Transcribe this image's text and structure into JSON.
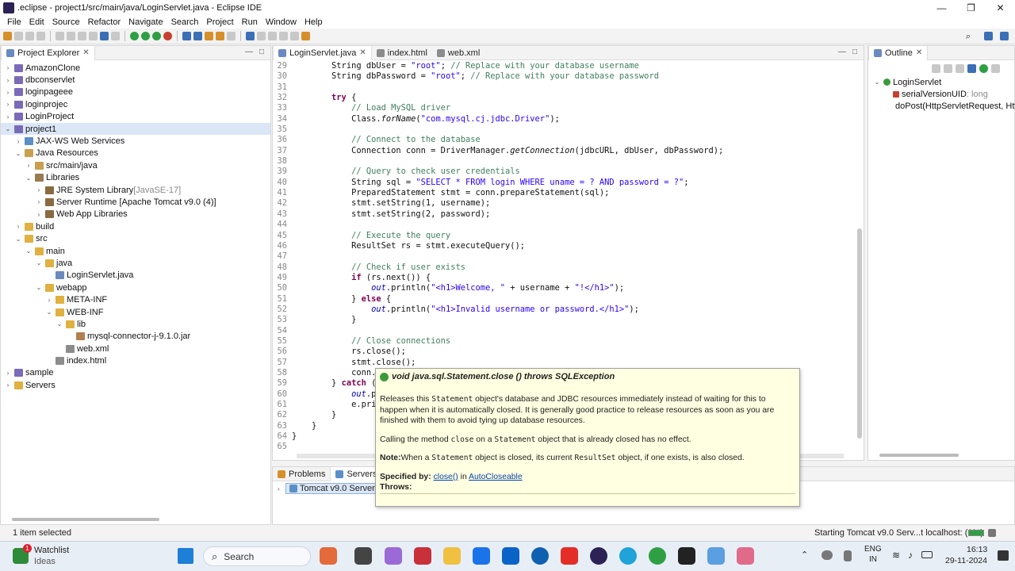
{
  "window": {
    "title": ".eclipse - project1/src/main/java/LoginServlet.java - Eclipse IDE",
    "controls": [
      "—",
      "❐",
      "✕"
    ]
  },
  "menu": [
    "File",
    "Edit",
    "Source",
    "Refactor",
    "Navigate",
    "Search",
    "Project",
    "Run",
    "Window",
    "Help"
  ],
  "explorer": {
    "title": "Project Explorer",
    "rows": [
      {
        "label": "AmazonClone",
        "deco": "",
        "indent": 0,
        "arrow": "›",
        "icon": "project-icon",
        "color": "#7a6bb8"
      },
      {
        "label": "dbconservlet",
        "deco": "",
        "indent": 0,
        "arrow": "›",
        "icon": "project-icon",
        "color": "#7a6bb8"
      },
      {
        "label": "loginpageee",
        "deco": "",
        "indent": 0,
        "arrow": "›",
        "icon": "project-icon",
        "color": "#7a6bb8"
      },
      {
        "label": "loginprojec",
        "deco": "",
        "indent": 0,
        "arrow": "›",
        "icon": "project-icon",
        "color": "#7a6bb8"
      },
      {
        "label": "LoginProject",
        "deco": "",
        "indent": 0,
        "arrow": "›",
        "icon": "project-icon",
        "color": "#7a6bb8"
      },
      {
        "label": "project1",
        "deco": "",
        "indent": 0,
        "arrow": "⌄",
        "icon": "project-icon",
        "color": "#7a6bb8",
        "selected": true
      },
      {
        "label": "JAX-WS Web Services",
        "deco": "",
        "indent": 1,
        "arrow": "›",
        "icon": "webservice-icon",
        "color": "#5a8fc8"
      },
      {
        "label": "Java Resources",
        "deco": "",
        "indent": 1,
        "arrow": "⌄",
        "icon": "java-resources-icon",
        "color": "#c8a050"
      },
      {
        "label": "src/main/java",
        "deco": "",
        "indent": 2,
        "arrow": "›",
        "icon": "source-folder-icon",
        "color": "#c8a050"
      },
      {
        "label": "Libraries",
        "deco": "",
        "indent": 2,
        "arrow": "⌄",
        "icon": "libraries-icon",
        "color": "#9a7a50"
      },
      {
        "label": "JRE System Library ",
        "deco": "[JavaSE-17]",
        "indent": 3,
        "arrow": "›",
        "icon": "library-icon",
        "color": "#8a6a40"
      },
      {
        "label": "Server Runtime [Apache Tomcat v9.0 (4)]",
        "deco": "",
        "indent": 3,
        "arrow": "›",
        "icon": "library-icon",
        "color": "#8a6a40"
      },
      {
        "label": "Web App Libraries",
        "deco": "",
        "indent": 3,
        "arrow": "›",
        "icon": "library-icon",
        "color": "#8a6a40"
      },
      {
        "label": "build",
        "deco": "",
        "indent": 1,
        "arrow": "›",
        "icon": "folder-icon",
        "color": "#e0b040"
      },
      {
        "label": "src",
        "deco": "",
        "indent": 1,
        "arrow": "⌄",
        "icon": "folder-icon",
        "color": "#e0b040"
      },
      {
        "label": "main",
        "deco": "",
        "indent": 2,
        "arrow": "⌄",
        "icon": "folder-icon",
        "color": "#e0b040"
      },
      {
        "label": "java",
        "deco": "",
        "indent": 3,
        "arrow": "⌄",
        "icon": "folder-icon",
        "color": "#e0b040"
      },
      {
        "label": "LoginServlet.java",
        "deco": "",
        "indent": 4,
        "arrow": "",
        "icon": "java-file-icon",
        "color": "#6a8ac0"
      },
      {
        "label": "webapp",
        "deco": "",
        "indent": 3,
        "arrow": "⌄",
        "icon": "folder-icon",
        "color": "#e0b040"
      },
      {
        "label": "META-INF",
        "deco": "",
        "indent": 4,
        "arrow": "›",
        "icon": "folder-icon",
        "color": "#e0b040"
      },
      {
        "label": "WEB-INF",
        "deco": "",
        "indent": 4,
        "arrow": "⌄",
        "icon": "folder-icon",
        "color": "#e0b040"
      },
      {
        "label": "lib",
        "deco": "",
        "indent": 5,
        "arrow": "⌄",
        "icon": "folder-icon",
        "color": "#e0b040"
      },
      {
        "label": "mysql-connector-j-9.1.0.jar",
        "deco": "",
        "indent": 6,
        "arrow": "",
        "icon": "jar-icon",
        "color": "#b08050"
      },
      {
        "label": "web.xml",
        "deco": "",
        "indent": 5,
        "arrow": "",
        "icon": "xml-file-icon",
        "color": "#8c8c8c"
      },
      {
        "label": "index.html",
        "deco": "",
        "indent": 4,
        "arrow": "",
        "icon": "html-file-icon",
        "color": "#8c8c8c"
      },
      {
        "label": "sample",
        "deco": "",
        "indent": 0,
        "arrow": "›",
        "icon": "project-icon",
        "color": "#7a6bb8"
      },
      {
        "label": "Servers",
        "deco": "",
        "indent": 0,
        "arrow": "›",
        "icon": "folder-icon",
        "color": "#e0b040"
      }
    ]
  },
  "editor": {
    "tabs": [
      {
        "label": "LoginServlet.java",
        "active": true,
        "close": "✕"
      },
      {
        "label": "index.html",
        "active": false,
        "close": ""
      },
      {
        "label": "web.xml",
        "active": false,
        "close": ""
      }
    ],
    "lines": [
      {
        "n": "29",
        "t": "        String dbUser = \"root\"; // Replace with your database username"
      },
      {
        "n": "30",
        "t": "        String dbPassword = \"root\"; // Replace with your database password"
      },
      {
        "n": "31",
        "t": ""
      },
      {
        "n": "32",
        "t": "        try {"
      },
      {
        "n": "33",
        "t": "            // Load MySQL driver"
      },
      {
        "n": "34",
        "t": "            Class.forName(\"com.mysql.cj.jdbc.Driver\");"
      },
      {
        "n": "35",
        "t": ""
      },
      {
        "n": "36",
        "t": "            // Connect to the database"
      },
      {
        "n": "37",
        "t": "            Connection conn = DriverManager.getConnection(jdbcURL, dbUser, dbPassword);"
      },
      {
        "n": "38",
        "t": ""
      },
      {
        "n": "39",
        "t": "            // Query to check user credentials"
      },
      {
        "n": "40",
        "t": "            String sql = \"SELECT * FROM login WHERE uname = ? AND password = ?\";"
      },
      {
        "n": "41",
        "t": "            PreparedStatement stmt = conn.prepareStatement(sql);"
      },
      {
        "n": "42",
        "t": "            stmt.setString(1, username);"
      },
      {
        "n": "43",
        "t": "            stmt.setString(2, password);"
      },
      {
        "n": "44",
        "t": ""
      },
      {
        "n": "45",
        "t": "            // Execute the query"
      },
      {
        "n": "46",
        "t": "            ResultSet rs = stmt.executeQuery();"
      },
      {
        "n": "47",
        "t": ""
      },
      {
        "n": "48",
        "t": "            // Check if user exists"
      },
      {
        "n": "49",
        "t": "            if (rs.next()) {"
      },
      {
        "n": "50",
        "t": "                out.println(\"<h1>Welcome, \" + username + \"!</h1>\");"
      },
      {
        "n": "51",
        "t": "            } else {"
      },
      {
        "n": "52",
        "t": "                out.println(\"<h1>Invalid username or password.</h1>\");"
      },
      {
        "n": "53",
        "t": "            }"
      },
      {
        "n": "54",
        "t": ""
      },
      {
        "n": "55",
        "t": "            // Close connections"
      },
      {
        "n": "56",
        "t": "            rs.close();"
      },
      {
        "n": "57",
        "t": "            stmt.close();"
      },
      {
        "n": "58",
        "t": "            conn."
      },
      {
        "n": "59",
        "t": "        } catch ("
      },
      {
        "n": "60",
        "t": "            out.p"
      },
      {
        "n": "61",
        "t": "            e.pri"
      },
      {
        "n": "62",
        "t": "        }"
      },
      {
        "n": "63",
        "t": "    }"
      },
      {
        "n": "64",
        "t": "}"
      },
      {
        "n": "65",
        "t": ""
      }
    ]
  },
  "tooltip": {
    "signature": "void java.sql.Statement.close () throws SQLException",
    "p1_a": "Releases this ",
    "p1_code1": "Statement",
    "p1_b": " object's database and JDBC resources immediately instead of waiting for this to happen when it is automatically closed. It is generally good practice to release resources as soon as you are finished with them to avoid tying up database resources.",
    "p2_a": "Calling the method ",
    "p2_code1": "close",
    "p2_b": " on a ",
    "p2_code2": "Statement",
    "p2_c": " object that is already closed has no effect.",
    "note_label": "Note:",
    "note_a": "When a ",
    "note_code1": "Statement",
    "note_b": " object is closed, its current ",
    "note_code2": "ResultSet",
    "note_c": " object, if one exists, is also closed.",
    "spec_label": "Specified by:",
    "spec_link1": "close()",
    "spec_in": " in ",
    "spec_link2": "AutoCloseable",
    "throws_label": "Throws:"
  },
  "outline": {
    "title": "Outline",
    "items": [
      {
        "label": "LoginServlet",
        "sub": ""
      },
      {
        "label": "serialVersionUID",
        "sub": " : long"
      },
      {
        "label": "doPost(HttpServletRequest, Htt",
        "sub": ""
      }
    ]
  },
  "bottom": {
    "tabs": [
      "Problems",
      "Servers"
    ],
    "server_row": "Tomcat v9.0 Server at lo"
  },
  "status": {
    "left": "1 item selected",
    "right": "Starting Tomcat v9.0 Serv...t localhost: (0%)"
  },
  "taskbar": {
    "watch_title": "Watchlist",
    "watch_sub": "Ideas",
    "watch_badge": "1",
    "search_label": "Search",
    "lang1": "ENG",
    "lang2": "IN",
    "time": "16:13",
    "date": "29-11-2024"
  }
}
